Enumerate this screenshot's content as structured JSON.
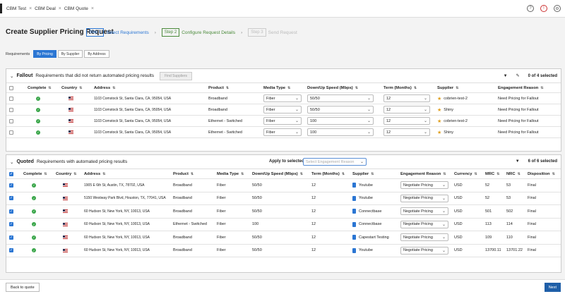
{
  "tabs": [
    "CBM Test",
    "CBM Deal",
    "CBM Quote"
  ],
  "page_title": "Create Supplier Pricing Request",
  "steps": [
    {
      "num": "Step 1",
      "label": "Select Requirements"
    },
    {
      "num": "Step 2",
      "label": "Configure Request Details"
    },
    {
      "num": "Step 3",
      "label": "Send Request"
    }
  ],
  "req_label": "Requirements",
  "req_buttons": [
    "By Pricing",
    "By Supplier",
    "By Address"
  ],
  "fallout": {
    "title": "Fallout",
    "subtitle": "Requirements that did not return automated pricing results",
    "find_btn": "Find Suppliers",
    "selected": "0 of 4 selected",
    "headers": [
      "Complete",
      "Country",
      "Address",
      "Product",
      "Media Type",
      "Down/Up Speed (Mbps)",
      "Term (Months)",
      "Supplier",
      "Engagement Reason"
    ],
    "rows": [
      [
        "1103 Comstock St, Santa Clara, CA, 95054, USA",
        "Broadband",
        "Fiber",
        "50/50",
        "12",
        "cobrien-test-2",
        "Need Pricing for Fallout"
      ],
      [
        "1103 Comstock St, Santa Clara, CA, 95054, USA",
        "Broadband",
        "Fiber",
        "50/50",
        "12",
        "Shiny",
        "Need Pricing for Fallout"
      ],
      [
        "1103 Comstock St, Santa Clara, CA, 95054, USA",
        "Ethernet - Switched",
        "Fiber",
        "100",
        "12",
        "cobrien-test-2",
        "Need Pricing for Fallout"
      ],
      [
        "1103 Comstock St, Santa Clara, CA, 95054, USA",
        "Ethernet - Switched",
        "Fiber",
        "100",
        "12",
        "Shiny",
        "Need Pricing for Fallout"
      ]
    ]
  },
  "quoted": {
    "title": "Quoted",
    "subtitle": "Requirements with automated pricing results",
    "apply_label": "Apply to selected:",
    "apply_placeholder": "Select Engagement Reason",
    "selected": "6 of 6 selected",
    "headers": [
      "Complete",
      "Country",
      "Address",
      "Product",
      "Media Type",
      "Down/Up Speed (Mbps)",
      "Term (Months)",
      "Supplier",
      "Engagement Reason",
      "Currency",
      "MRC",
      "NRC",
      "Disposition"
    ],
    "rows": [
      [
        "1905 E 6th St, Austin, TX, 78702, USA",
        "Broadband",
        "Fiber",
        "50/50",
        "12",
        "Youtube",
        "Negotiate Pricing",
        "USD",
        "52",
        "53",
        "Final"
      ],
      [
        "5150 Westway Park Blvd, Houston, TX, 77041, USA",
        "Broadband",
        "Fiber",
        "50/50",
        "12",
        "Youtube",
        "Negotiate Pricing",
        "USD",
        "52",
        "53",
        "Final"
      ],
      [
        "60 Hudson St, New York, NY, 10013, USA",
        "Broadband",
        "Fiber",
        "50/50",
        "12",
        "Connectbase",
        "Negotiate Pricing",
        "USD",
        "501",
        "502",
        "Final"
      ],
      [
        "60 Hudson St, New York, NY, 10013, USA",
        "Ethernet - Switched",
        "Fiber",
        "100",
        "12",
        "Connectbase",
        "Negotiate Pricing",
        "USD",
        "113",
        "114",
        "Final"
      ],
      [
        "60 Hudson St, New York, NY, 10013, USA",
        "Broadband",
        "Fiber",
        "50/50",
        "12",
        "Capestart Testing",
        "Negotiate Pricing",
        "USD",
        "109",
        "110",
        "Final"
      ],
      [
        "60 Hudson St, New York, NY, 10013, USA",
        "Broadband",
        "Fiber",
        "50/50",
        "12",
        "Youtube",
        "Negotiate Pricing",
        "USD",
        "13700.11",
        "13701.22",
        "Final"
      ]
    ]
  },
  "footer": {
    "back": "Back to quote",
    "next": "Next"
  }
}
